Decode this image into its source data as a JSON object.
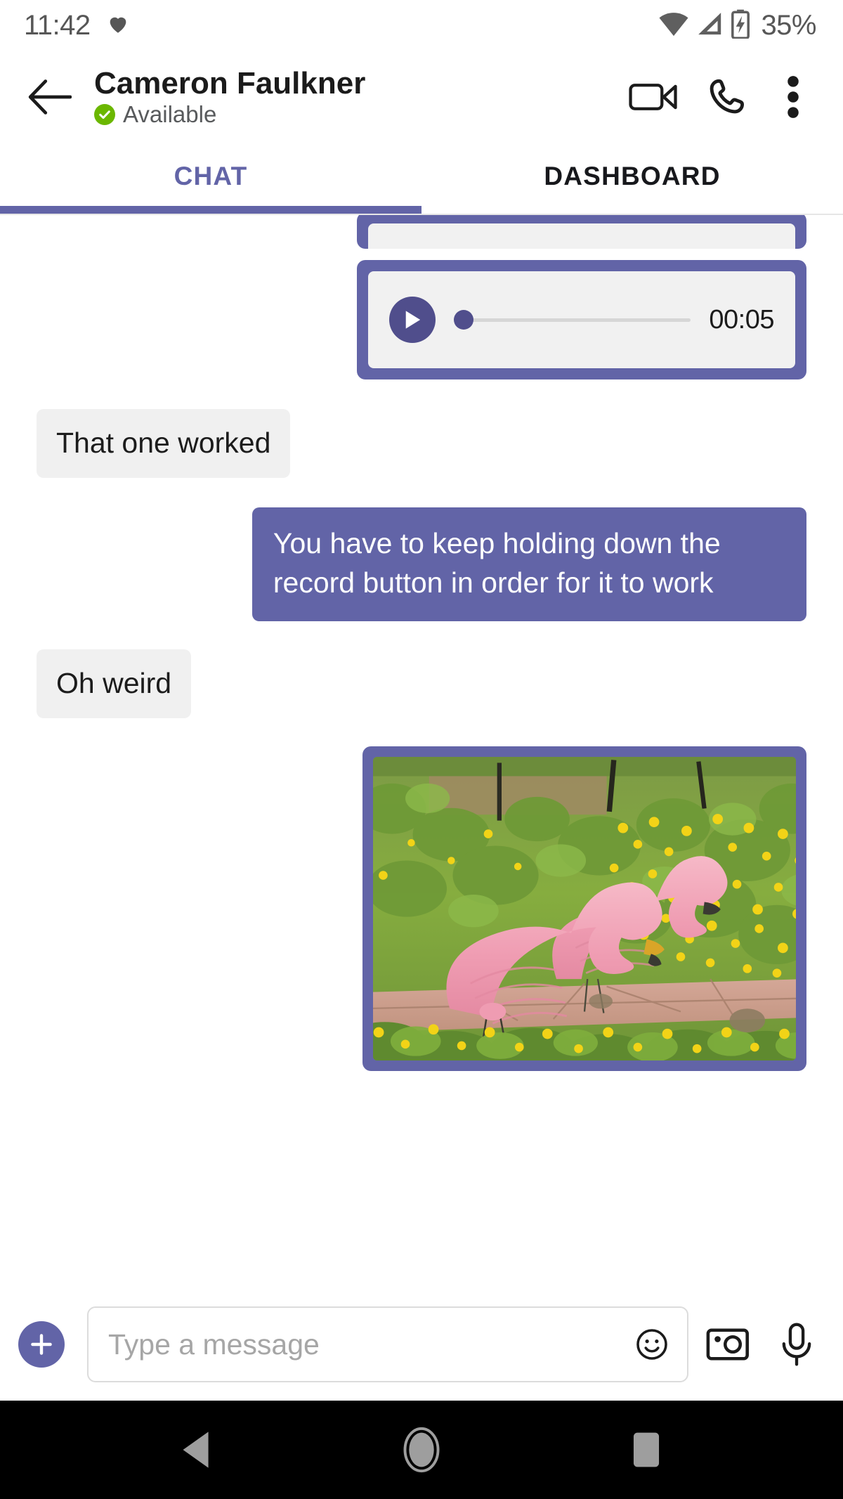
{
  "status_bar": {
    "time": "11:42",
    "battery_percent": "35%",
    "icons": {
      "heart": "heart-icon",
      "wifi": "wifi-icon",
      "cellular": "cellular-signal-icon",
      "battery": "battery-charging-icon"
    }
  },
  "header": {
    "back_label": "back-arrow",
    "contact_name": "Cameron Faulkner",
    "presence_status": "Available",
    "presence_color": "#6bb700",
    "actions": {
      "video_call": "video-call",
      "audio_call": "audio-call",
      "more": "more-options"
    }
  },
  "tabs": {
    "items": [
      {
        "label": "CHAT",
        "active": true
      },
      {
        "label": "DASHBOARD",
        "active": false
      }
    ],
    "accent_color": "#6264a7"
  },
  "messages": [
    {
      "id": "m0",
      "type": "audio",
      "direction": "out",
      "clipped": true,
      "duration": ""
    },
    {
      "id": "m1",
      "type": "audio",
      "direction": "out",
      "clipped": false,
      "duration": "00:05"
    },
    {
      "id": "m2",
      "type": "text",
      "direction": "in",
      "text": "That one worked"
    },
    {
      "id": "m3",
      "type": "text",
      "direction": "out",
      "text": "You have to keep holding down the record button in order for it to work"
    },
    {
      "id": "m4",
      "type": "text",
      "direction": "in",
      "text": "Oh weird"
    },
    {
      "id": "m5",
      "type": "image",
      "direction": "out",
      "alt": "Two pink plastic lawn flamingos standing in a garden of green foliage with yellow flowers beside a paved path"
    }
  ],
  "composer": {
    "add_label": "add-attachment",
    "placeholder": "Type a message",
    "value": "",
    "emoji_label": "emoji-picker",
    "camera_label": "camera",
    "mic_label": "microphone"
  },
  "nav_bar": {
    "back": "android-back",
    "home": "android-home",
    "recents": "android-recents"
  },
  "colors": {
    "accent_purple": "#6264a7",
    "incoming_bubble": "#f0f0f0",
    "presence_green": "#6bb700",
    "nav_bar_bg": "#000000"
  }
}
